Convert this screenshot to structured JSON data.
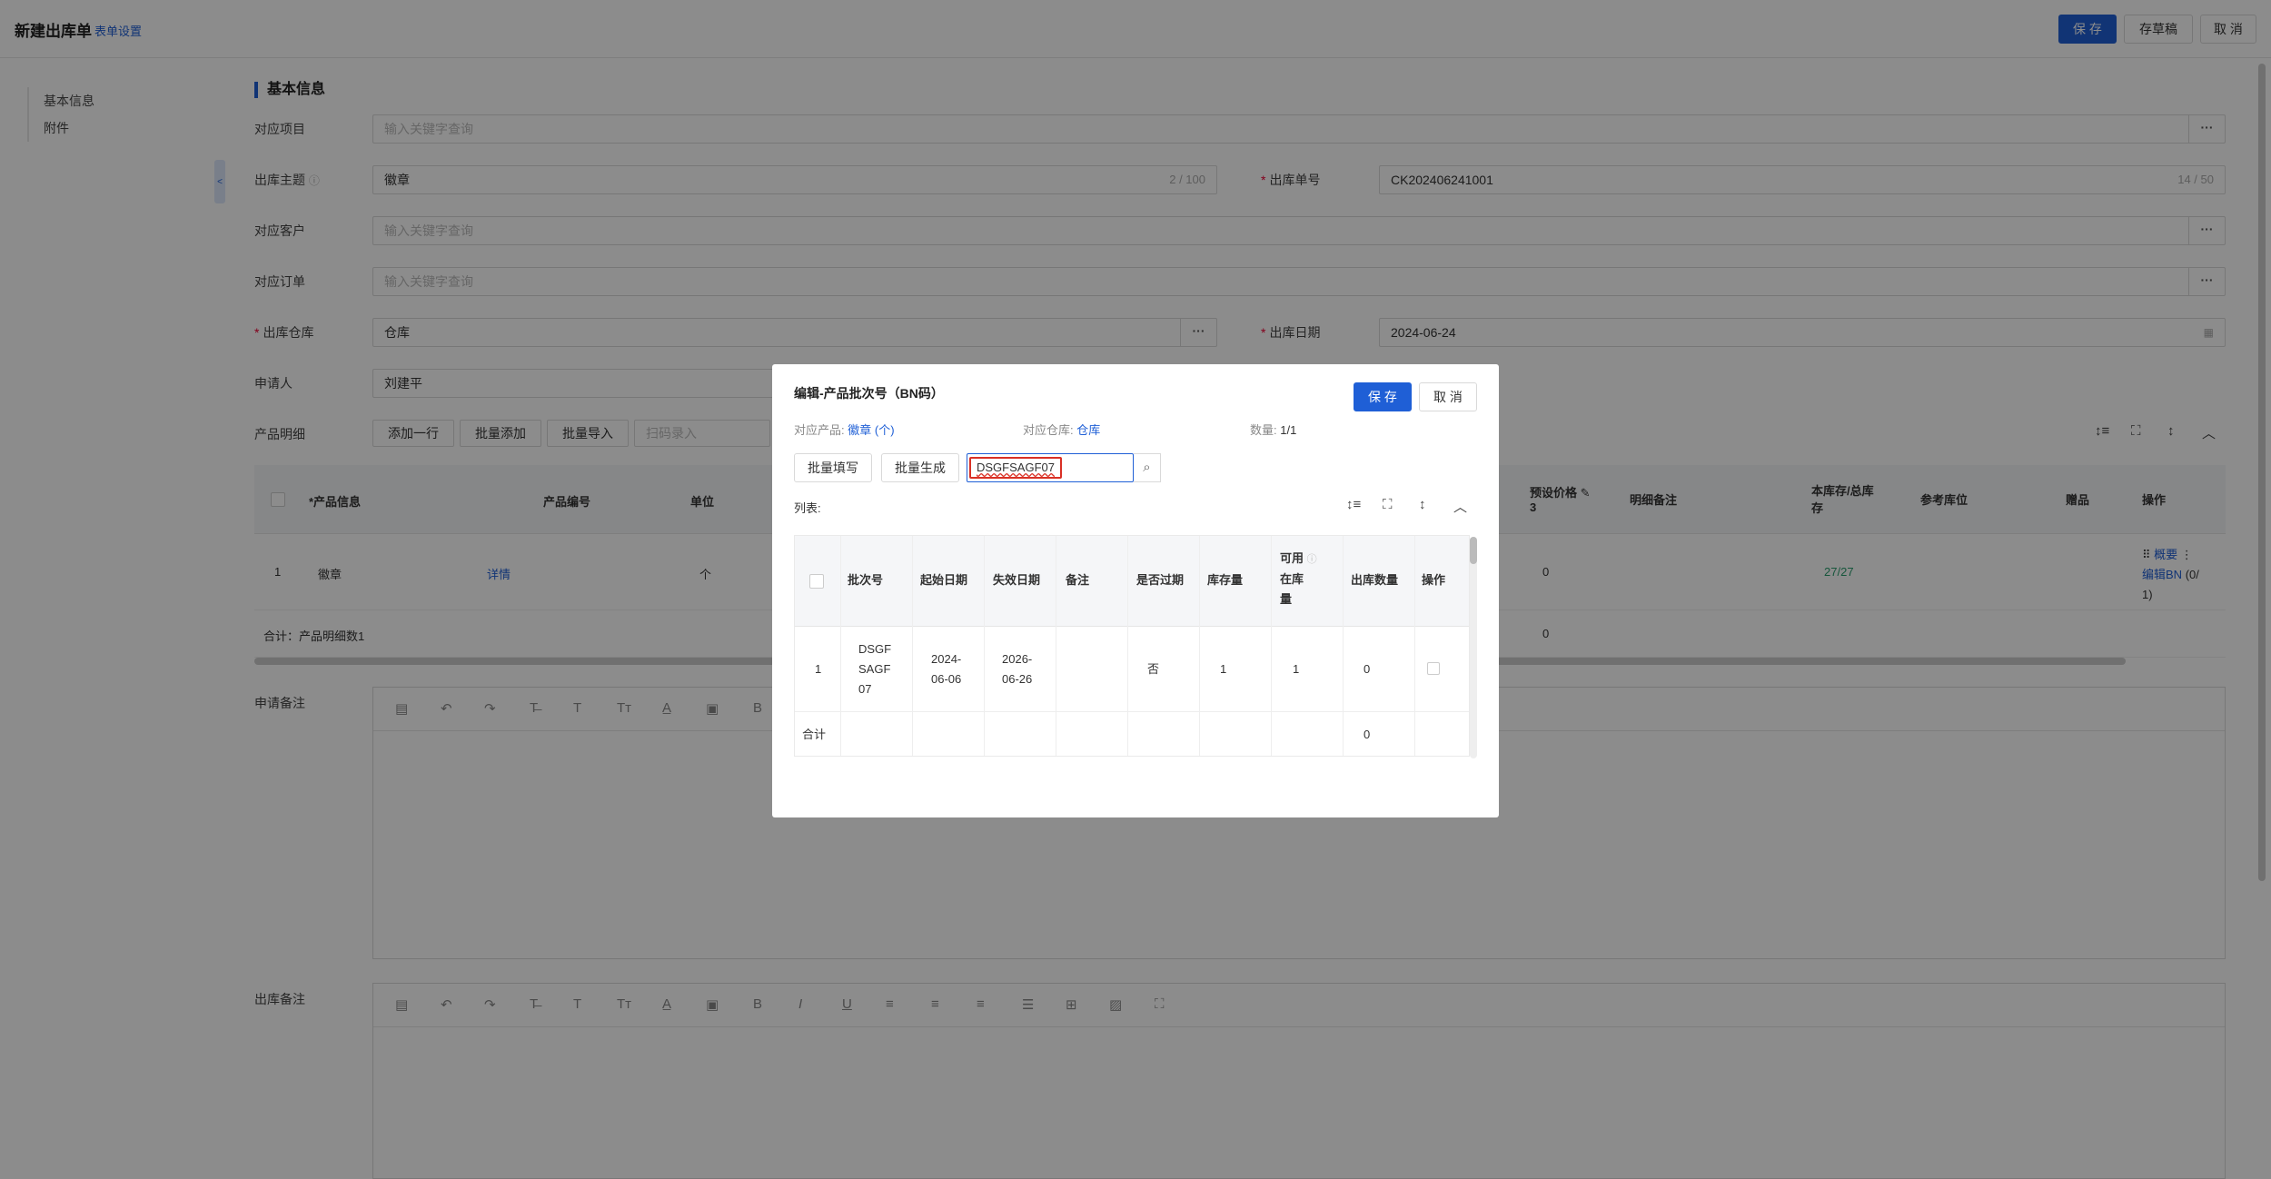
{
  "header": {
    "title": "新建出库单",
    "form_settings": "表单设置",
    "save": "保 存",
    "draft": "存草稿",
    "cancel": "取 消"
  },
  "sidenav": {
    "items": [
      "基本信息",
      "附件"
    ]
  },
  "section": {
    "title": "基本信息"
  },
  "form": {
    "project_label": "对应项目",
    "project_placeholder": "输入关键字查询",
    "subject_label": "出库主题",
    "subject_value": "徽章",
    "subject_count": "2 / 100",
    "number_label": "出库单号",
    "number_value": "CK202406241001",
    "number_count": "14 / 50",
    "customer_label": "对应客户",
    "customer_placeholder": "输入关键字查询",
    "order_label": "对应订单",
    "order_placeholder": "输入关键字查询",
    "warehouse_label": "出库仓库",
    "warehouse_value": "仓库",
    "date_label": "出库日期",
    "date_value": "2024-06-24",
    "applicant_label": "申请人",
    "applicant_value": "刘建平",
    "more": "···",
    "calendar_icon": "calendar-icon"
  },
  "detail": {
    "label": "产品明细",
    "add_row": "添加一行",
    "batch_add": "批量添加",
    "batch_import": "批量导入",
    "scan_placeholder": "扫码录入",
    "headers": {
      "product_info": "*产品信息",
      "product_code": "产品编号",
      "unit": "单位",
      "preset_price": "预设价格",
      "preset_price_sub": "3",
      "note": "明细备注",
      "stock": "本库存/总库",
      "stock_sub": "存",
      "location": "参考库位",
      "gift": "赠品",
      "action": "操作"
    },
    "row": {
      "index": "1",
      "product": "徽章",
      "detail_link": "详情",
      "unit": "个",
      "price": "0",
      "stock_a": "27",
      "stock_b": "27",
      "action_overview": "概要",
      "action_edit": "编辑BN",
      "action_count": "(0/",
      "action_count2": "1)"
    },
    "sum": {
      "label": "合计：产品明细数1",
      "price": "0"
    }
  },
  "remarks": {
    "apply_label": "申请备注",
    "out_label": "出库备注"
  },
  "modal": {
    "title": "编辑-产品批次号（BN码）",
    "save": "保 存",
    "cancel": "取 消",
    "product_label": "对应产品:",
    "product_value": "徽章 (个)",
    "warehouse_label": "对应仓库:",
    "warehouse_value": "仓库",
    "qty_label": "数量:",
    "qty_value": "1/1",
    "batch_fill": "批量填写",
    "batch_generate": "批量生成",
    "search_value": "DSGFSAGF07",
    "list_label": "列表:",
    "headers": {
      "batch_no": "批次号",
      "start_date": "起始日期",
      "expire_date": "失效日期",
      "remark": "备注",
      "expired": "是否过期",
      "stock": "库存量",
      "available_1": "可用",
      "available_2": "在库",
      "available_3": "量",
      "out_qty": "出库数量",
      "action": "操作"
    },
    "row": {
      "index": "1",
      "batch_1": "DSGF",
      "batch_2": "SAGF",
      "batch_3": "07",
      "start_1": "2024-",
      "start_2": "06-06",
      "expire_1": "2026-",
      "expire_2": "06-26",
      "expired": "否",
      "stock": "1",
      "available": "1",
      "out_qty": "0"
    },
    "sum": {
      "label": "合计",
      "out_qty": "0"
    }
  }
}
